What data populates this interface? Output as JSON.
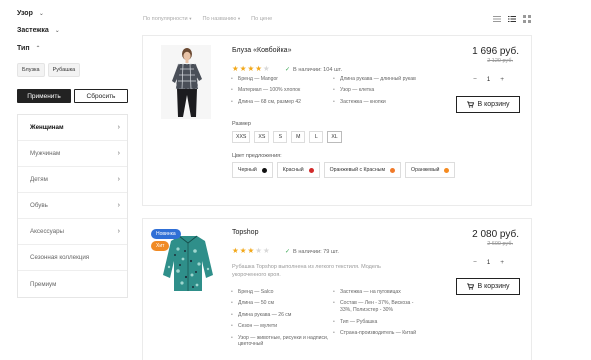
{
  "filters": {
    "pattern": {
      "title": "Узор"
    },
    "fastener": {
      "title": "Застежка"
    },
    "type": {
      "title": "Тип",
      "chips": [
        "Блузка",
        "Рубашка"
      ]
    },
    "apply_label": "Применить",
    "reset_label": "Сбросить"
  },
  "categories": [
    {
      "label": "Женщинам",
      "arrow": "›",
      "active": true
    },
    {
      "label": "Мужчинам",
      "arrow": "›"
    },
    {
      "label": "Детям",
      "arrow": "›"
    },
    {
      "label": "Обувь",
      "arrow": "›"
    },
    {
      "label": "Аксессуары",
      "arrow": "›"
    },
    {
      "label": "Сезонная коллекция",
      "arrow": ""
    },
    {
      "label": "Премиум",
      "arrow": ""
    }
  ],
  "sort": {
    "popularity": "По популярности",
    "name": "По названию",
    "price": "По цене"
  },
  "products": [
    {
      "title": "Блуза «Ковбойка»",
      "rating": 4,
      "stock": "В наличии: 104 шт.",
      "props_left": [
        "Бренд — Mangor",
        "Материал — 100% хлопок",
        "Длина — 68 см, размер 42"
      ],
      "props_right": [
        "Длина рукава — длинный рукав",
        "Узор — клетка",
        "Застежка — кнопки"
      ],
      "price": "1 696 руб.",
      "old_price": "2 120 руб.",
      "qty": "1",
      "cart_label": "В корзину",
      "size_label": "Размер",
      "sizes": [
        "XXS",
        "XS",
        "S",
        "M",
        "L",
        "XL"
      ],
      "color_label": "Цвет предложения:",
      "colors": [
        {
          "label": "Черный",
          "hex": "#111111"
        },
        {
          "label": "Красный",
          "hex": "#d12a2a"
        },
        {
          "label": "Оранжевый с Красным",
          "hex": "#f07a2a"
        },
        {
          "label": "Оранжевый",
          "hex": "#f58a1f"
        }
      ]
    },
    {
      "title": "Topshop",
      "rating": 3,
      "stock": "В наличии: 79 шт.",
      "badges": [
        {
          "label": "Новинка",
          "color": "#2f6fd6"
        },
        {
          "label": "Хит",
          "color": "#f08a24"
        }
      ],
      "description": "Рубашка Topshop выполнена из легкого текстиля. Модель укороченного кроя.",
      "props_left": [
        "Бренд — Salco",
        "Длина — 50 см",
        "Длина рукава — 26 см",
        "Сезон — мулети",
        "Узор — животные, рисунки и надписи, цветочный"
      ],
      "props_right": [
        "Застежка — на пуговицах",
        "Состав — Лен - 37%, Вискоза - 33%, Полиэстер - 30%",
        "Тип — Рубашка",
        "Страна-производитель — Китай"
      ],
      "price": "2 080 руб.",
      "old_price": "2 600 руб.",
      "qty": "1",
      "cart_label": "В корзину"
    }
  ],
  "icons": {
    "view_list": "list-view-icon",
    "view_table": "table-view-icon",
    "view_grid": "grid-view-icon",
    "cart": "cart-icon",
    "check": "check-icon"
  }
}
